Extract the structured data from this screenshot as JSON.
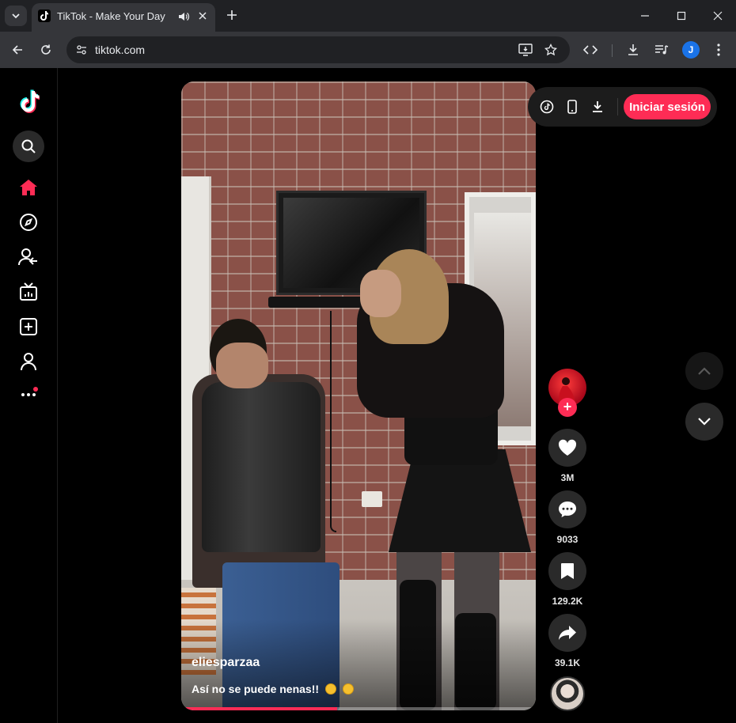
{
  "browser": {
    "tab": {
      "title": "TikTok - Make Your Day"
    },
    "address_bar": {
      "url": "tiktok.com"
    },
    "profile_initial": "J"
  },
  "sidebar": {
    "items": [
      {
        "name": "search",
        "icon": "search-icon"
      },
      {
        "name": "home",
        "icon": "home-icon",
        "active": true
      },
      {
        "name": "explore",
        "icon": "compass-icon"
      },
      {
        "name": "following",
        "icon": "user-follow-icon"
      },
      {
        "name": "live",
        "icon": "tv-icon"
      },
      {
        "name": "upload",
        "icon": "plus-square-icon"
      },
      {
        "name": "profile",
        "icon": "user-icon"
      },
      {
        "name": "more",
        "icon": "more-dots-icon",
        "badge": true
      }
    ]
  },
  "video": {
    "author": "eliesparzaa",
    "caption": "Así no se puede nenas!!",
    "caption_emojis": [
      "smiling-face-icon",
      "tears-of-joy-icon"
    ],
    "progress": 0.44
  },
  "actions": {
    "likes": "3M",
    "comments": "9033",
    "saves": "129.2K",
    "shares": "39.1K"
  },
  "top_actions": {
    "login_label": "Iniciar sesión"
  },
  "colors": {
    "accent": "#fe2c55",
    "background": "#000000",
    "chrome_dark": "#202124",
    "chrome_toolbar": "#35363a"
  }
}
